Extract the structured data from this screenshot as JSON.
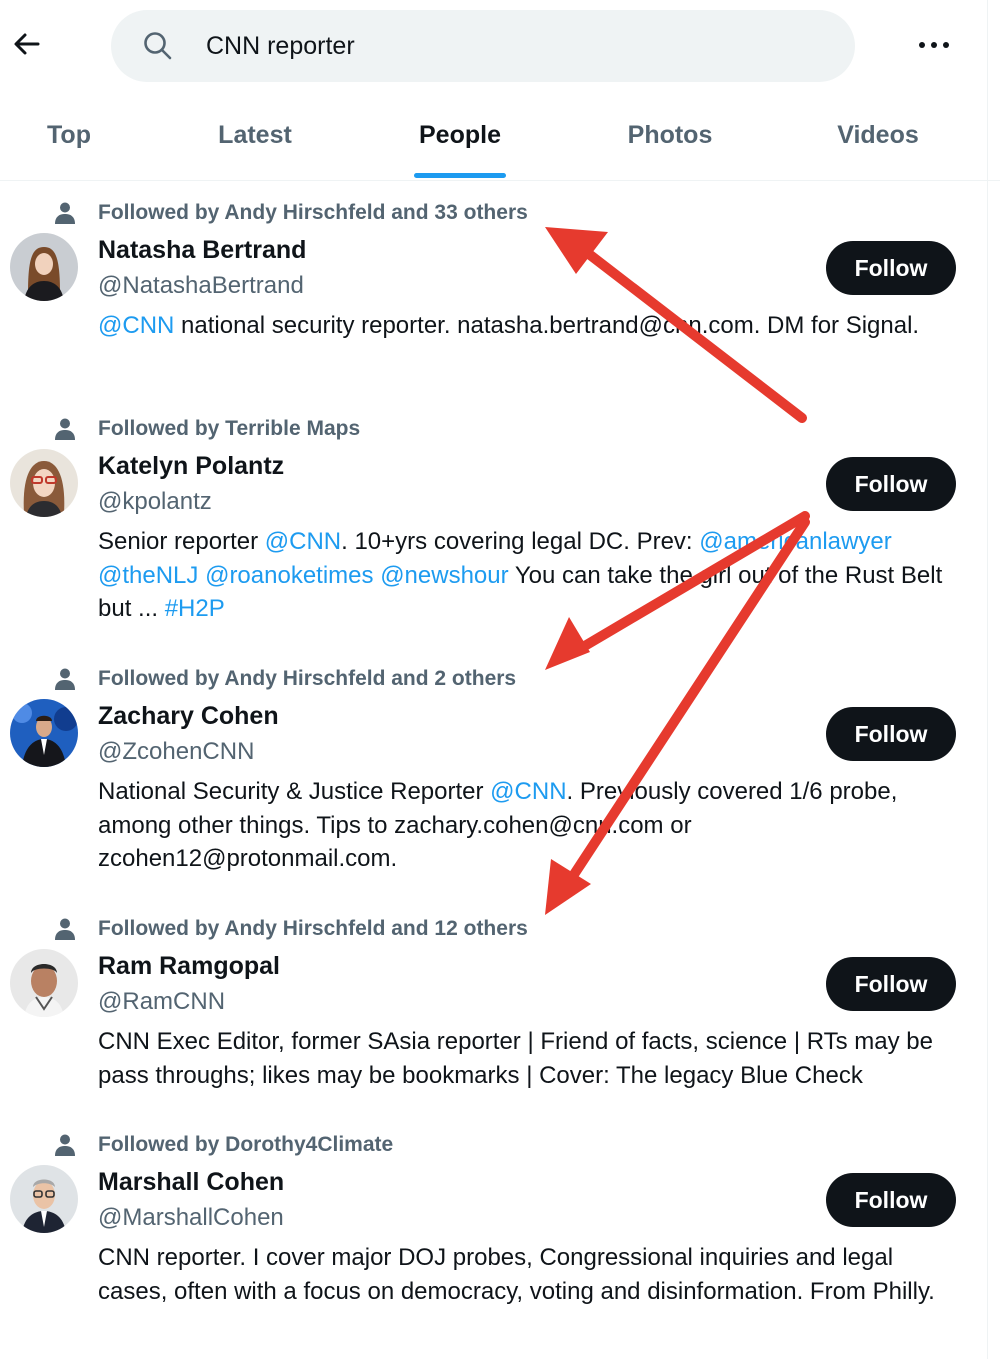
{
  "search": {
    "query": "CNN reporter"
  },
  "icons": {
    "back": "arrow-left-icon",
    "search": "search-icon",
    "more": "more-icon",
    "followed": "person-icon"
  },
  "colors": {
    "accent": "#1d9bf0",
    "text": "#0f1419",
    "muted": "#536471",
    "follow_bg": "#0f1419",
    "annotation_arrow": "#e63a2e"
  },
  "tabs": [
    {
      "label": "Top",
      "active": false
    },
    {
      "label": "Latest",
      "active": false
    },
    {
      "label": "People",
      "active": true
    },
    {
      "label": "Photos",
      "active": false
    },
    {
      "label": "Videos",
      "active": false
    }
  ],
  "people": [
    {
      "followed_by": "Followed by Andy Hirschfeld and 33 others",
      "name": "Natasha Bertrand",
      "handle": "@NatashaBertrand",
      "follow_label": "Follow",
      "bio": [
        {
          "t": "@CNN",
          "link": true
        },
        {
          "t": " national security reporter. natasha.bertrand@cnn.com. DM for Signal.",
          "link": false
        }
      ]
    },
    {
      "followed_by": "Followed by Terrible Maps",
      "name": "Katelyn Polantz",
      "handle": "@kpolantz",
      "follow_label": "Follow",
      "bio": [
        {
          "t": "Senior reporter ",
          "link": false
        },
        {
          "t": "@CNN",
          "link": true
        },
        {
          "t": ". 10+yrs covering legal DC. Prev: ",
          "link": false
        },
        {
          "t": "@americanlawyer",
          "link": true
        },
        {
          "t": " ",
          "link": false
        },
        {
          "t": "@theNLJ",
          "link": true
        },
        {
          "t": " ",
          "link": false
        },
        {
          "t": "@roanoketimes",
          "link": true
        },
        {
          "t": " ",
          "link": false
        },
        {
          "t": "@newshour",
          "link": true
        },
        {
          "t": " You can take the girl out of the Rust Belt but ... ",
          "link": false
        },
        {
          "t": "#H2P",
          "link": true
        }
      ]
    },
    {
      "followed_by": "Followed by Andy Hirschfeld and 2 others",
      "name": "Zachary Cohen",
      "handle": "@ZcohenCNN",
      "follow_label": "Follow",
      "bio": [
        {
          "t": "National Security & Justice Reporter ",
          "link": false
        },
        {
          "t": "@CNN",
          "link": true
        },
        {
          "t": ". Previously covered 1/6 probe, among other things. Tips to zachary.cohen@cnn.com or zcohen12@protonmail.com.",
          "link": false
        }
      ]
    },
    {
      "followed_by": "Followed by Andy Hirschfeld and 12 others",
      "name": "Ram Ramgopal",
      "handle": "@RamCNN",
      "follow_label": "Follow",
      "bio": [
        {
          "t": "CNN Exec Editor, former SAsia reporter | Friend of facts, science | RTs may be pass throughs; likes may be bookmarks | Cover: The legacy Blue Check",
          "link": false
        }
      ]
    },
    {
      "followed_by": "Followed by Dorothy4Climate",
      "name": "Marshall Cohen",
      "handle": "@MarshallCohen",
      "follow_label": "Follow",
      "bio": [
        {
          "t": "CNN reporter. I cover major DOJ probes, Congressional inquiries and legal cases, often with a focus on democracy, voting and disinformation. From Philly.",
          "link": false
        }
      ]
    }
  ]
}
